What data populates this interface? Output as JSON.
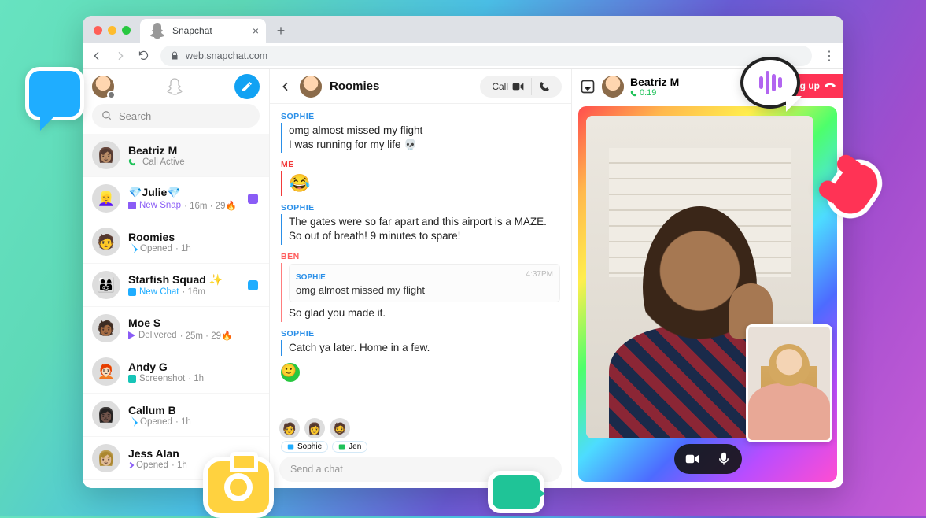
{
  "browser": {
    "tab_title": "Snapchat",
    "url": "web.snapchat.com"
  },
  "sidebar": {
    "search_placeholder": "Search",
    "conversations": [
      {
        "name": "Beatriz M",
        "sub_prefix": "",
        "sub": "Call Active",
        "style": "green",
        "icon": "call",
        "unread": ""
      },
      {
        "name": "💎Julie💎",
        "sub_prefix": "New Snap",
        "sub": " · 16m · 29🔥",
        "style": "purple",
        "icon": "newsnap-purple",
        "unread": "purple"
      },
      {
        "name": "Roomies",
        "sub_prefix": "Opened",
        "sub": " · 1h",
        "style": "",
        "icon": "opened-blue",
        "unread": ""
      },
      {
        "name": "Starfish Squad ✨",
        "sub_prefix": "New Chat",
        "sub": " · 16m",
        "style": "blue",
        "icon": "newchat-blue",
        "unread": "blue"
      },
      {
        "name": "Moe S",
        "sub_prefix": "Delivered",
        "sub": " · 25m · 29🔥",
        "style": "",
        "icon": "delivered-purple",
        "unread": ""
      },
      {
        "name": "Andy G",
        "sub_prefix": "Screenshot",
        "sub": " · 1h",
        "style": "",
        "icon": "screenshot-teal",
        "unread": ""
      },
      {
        "name": "Callum B",
        "sub_prefix": "Opened",
        "sub": " · 1h",
        "style": "",
        "icon": "opened-blue",
        "unread": ""
      },
      {
        "name": "Jess Alan",
        "sub_prefix": "Opened",
        "sub": " · 1h",
        "style": "",
        "icon": "opened-purple",
        "unread": ""
      }
    ]
  },
  "chat": {
    "title": "Roomies",
    "call_label": "Call",
    "messages": [
      {
        "sender": "SOPHIE",
        "cls": "sophie",
        "lines": [
          "omg almost missed my flight",
          "I was running for my life 💀"
        ]
      },
      {
        "sender": "ME",
        "cls": "me",
        "lines": [
          "😂"
        ]
      },
      {
        "sender": "SOPHIE",
        "cls": "sophie",
        "lines": [
          "The gates were so far apart and this airport is a MAZE.",
          "So out of breath! 9 minutes to spare!"
        ]
      },
      {
        "sender": "BEN",
        "cls": "ben",
        "quote": {
          "sender": "SOPHIE",
          "time": "4:37PM",
          "text": "omg almost missed my flight"
        },
        "lines": [
          "So glad you made it."
        ]
      },
      {
        "sender": "SOPHIE",
        "cls": "sophie",
        "lines": [
          "Catch ya later. Home in a few."
        ]
      }
    ],
    "presence": [
      {
        "name": "Sophie",
        "color": "#1fadff"
      },
      {
        "name": "Jen",
        "color": "#1fc259"
      }
    ],
    "input_placeholder": "Send a chat"
  },
  "call": {
    "name": "Beatriz M",
    "duration": "0:19",
    "hangup_label": "Hang up"
  },
  "colors": {
    "snap_yellow": "#fffc00",
    "snap_blue": "#1fadff",
    "snap_red": "#ff3355",
    "snap_green": "#1fc259",
    "snap_purple": "#8a5cf6"
  }
}
